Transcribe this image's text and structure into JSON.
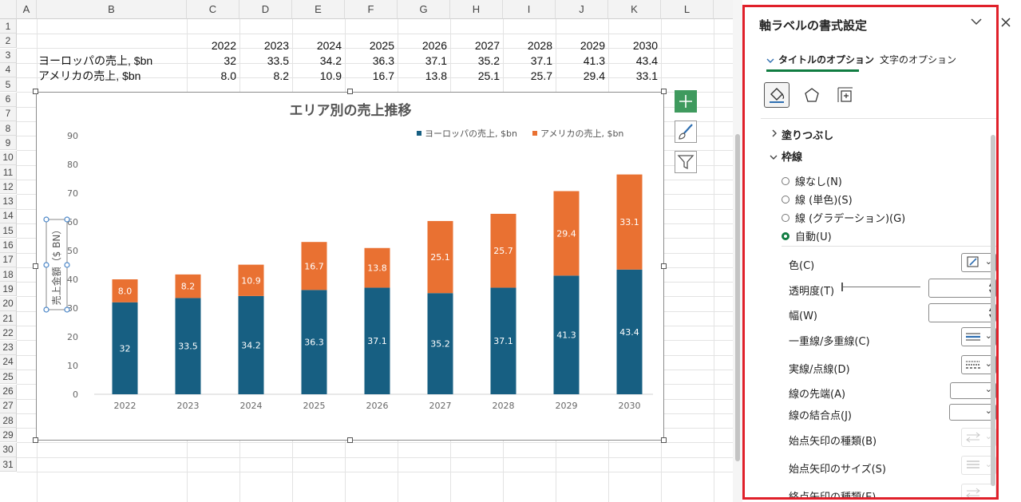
{
  "sheet": {
    "columns": [
      "A",
      "B",
      "C",
      "D",
      "E",
      "F",
      "G",
      "H",
      "I",
      "J",
      "K",
      "L"
    ],
    "rows": [
      "1",
      "2",
      "3",
      "4",
      "5",
      "6",
      "7",
      "8",
      "9",
      "10",
      "11",
      "12",
      "13",
      "14",
      "15",
      "16",
      "17",
      "18",
      "19",
      "20",
      "21",
      "22",
      "23",
      "24",
      "25",
      "26",
      "27",
      "28",
      "29",
      "30",
      "31"
    ],
    "years": [
      "2022",
      "2023",
      "2024",
      "2025",
      "2026",
      "2027",
      "2028",
      "2029",
      "2030"
    ],
    "europe_label": "ヨーロッパの売上, $bn",
    "europe_values": [
      "32",
      "33.5",
      "34.2",
      "36.3",
      "37.1",
      "35.2",
      "37.1",
      "41.3",
      "43.4"
    ],
    "america_label": "アメリカの売上, $bn",
    "america_values": [
      "8.0",
      "8.2",
      "10.9",
      "16.7",
      "13.8",
      "25.1",
      "25.7",
      "29.4",
      "33.1"
    ]
  },
  "chart_data": {
    "type": "bar",
    "stacked": true,
    "title": "エリア別の売上推移",
    "ylabel": "売上金額（$ BN）",
    "xlabel": "",
    "ylim": [
      0,
      90
    ],
    "yticks": [
      0,
      10,
      20,
      30,
      40,
      50,
      60,
      70,
      80,
      90
    ],
    "grid": false,
    "legend_position": "top-right",
    "categories": [
      "2022",
      "2023",
      "2024",
      "2025",
      "2026",
      "2027",
      "2028",
      "2029",
      "2030"
    ],
    "series": [
      {
        "name": "ヨーロッパの売上, $bn",
        "color": "#175f82",
        "values": [
          32,
          33.5,
          34.2,
          36.3,
          37.1,
          35.2,
          37.1,
          41.3,
          43.4
        ],
        "labels": [
          "32",
          "33.5",
          "34.2",
          "36.3",
          "37.1",
          "35.2",
          "37.1",
          "41.3",
          "43.4"
        ]
      },
      {
        "name": "アメリカの売上, $bn",
        "color": "#e97132",
        "values": [
          8.0,
          8.2,
          10.9,
          16.7,
          13.8,
          25.1,
          25.7,
          29.4,
          33.1
        ],
        "labels": [
          "8.0",
          "8.2",
          "10.9",
          "16.7",
          "13.8",
          "25.1",
          "25.7",
          "29.4",
          "33.1"
        ]
      }
    ]
  },
  "chart_buttons": [
    "plus-icon",
    "brush-icon",
    "filter-icon"
  ],
  "pane": {
    "title": "軸ラベルの書式設定",
    "tab_title_options": "タイトルのオプション",
    "tab_text_options": "文字のオプション",
    "icons": [
      "fill-line-icon",
      "effects-pentagon-icon",
      "size-properties-icon"
    ],
    "fill_section": "塗りつぶし",
    "border_section": "枠線",
    "radio_none": "線なし(N)",
    "radio_solid": "線 (単色)(S)",
    "radio_gradient": "線 (グラデーション)(G)",
    "radio_auto": "自動(U)",
    "selected_radio": "auto",
    "prop_color": "色(C)",
    "prop_transparency": "透明度(T)",
    "prop_width": "幅(W)",
    "prop_compound": "一重線/多重線(C)",
    "prop_dash": "実線/点線(D)",
    "prop_cap": "線の先端(A)",
    "prop_join": "線の結合点(J)",
    "prop_begin_arrow_type": "始点矢印の種類(B)",
    "prop_begin_arrow_size": "始点矢印のサイズ(S)",
    "prop_end_arrow_type": "終点矢印の種類(E)",
    "accent": "#107c41",
    "highlight_border": "#e0202a"
  }
}
